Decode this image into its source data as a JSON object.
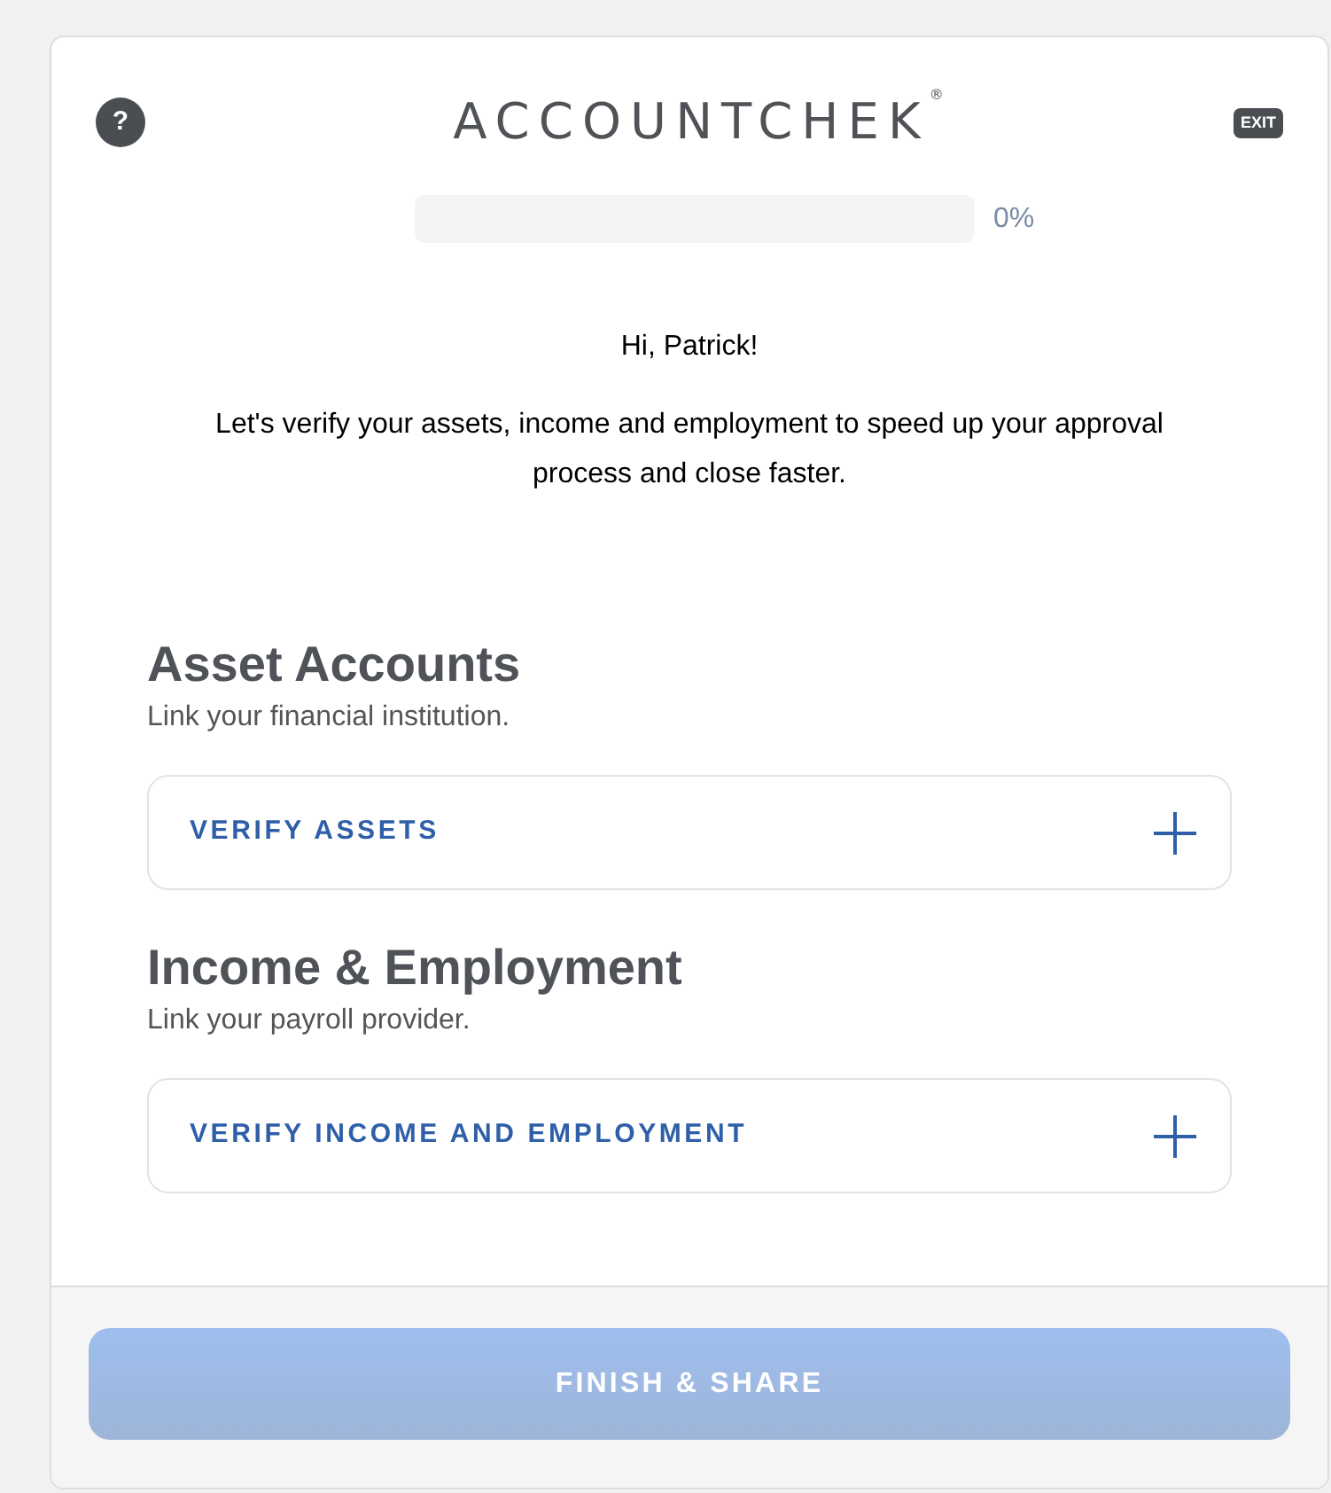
{
  "header": {
    "help_icon": "?",
    "logo": "ACCOUNTCHEK",
    "logo_mark": "®",
    "exit_icon": "EXIT"
  },
  "progress": {
    "level": 0,
    "reading": "0%"
  },
  "greeting": "Hi, Patrick!",
  "intro": "Let's verify your assets, income and employment to speed up your approval process and close faster.",
  "sections": [
    {
      "title": "Asset Accounts",
      "subtitle": "Link your financial institution.",
      "action": "VERIFY ASSETS"
    },
    {
      "title": "Income & Employment",
      "subtitle": "Link your payroll provider.",
      "action": "VERIFY INCOME AND EMPLOYMENT"
    }
  ],
  "footer": {
    "button": "FINISH & SHARE",
    "disabled": true
  }
}
